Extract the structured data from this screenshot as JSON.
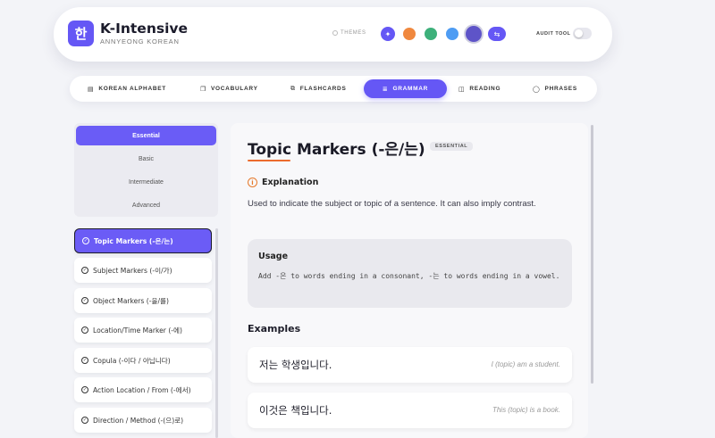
{
  "brand": {
    "logo_char": "한",
    "title": "K-Intensive",
    "subtitle": "ANNYEONG KOREAN"
  },
  "header": {
    "themes_label": "THEMES",
    "themes": [
      {
        "name": "indigo",
        "color": "#6557f5",
        "selected": true
      },
      {
        "name": "orange",
        "color": "#f0883e",
        "selected": false
      },
      {
        "name": "green",
        "color": "#3db07a",
        "selected": false
      },
      {
        "name": "blue",
        "color": "#4e9cf3",
        "selected": false
      },
      {
        "name": "dark",
        "color": "#5e54c8",
        "selected": false
      }
    ],
    "audit_label": "AUDIT TOOL",
    "audit_enabled": false
  },
  "nav": {
    "items": [
      {
        "label": "KOREAN ALPHABET",
        "icon": "book-icon",
        "active": false
      },
      {
        "label": "VOCABULARY",
        "icon": "copy-icon",
        "active": false
      },
      {
        "label": "FLASHCARDS",
        "icon": "cards-icon",
        "active": false
      },
      {
        "label": "GRAMMAR",
        "icon": "grammar-icon",
        "active": true
      },
      {
        "label": "READING",
        "icon": "open-book-icon",
        "active": false
      },
      {
        "label": "PHRASES",
        "icon": "chat-bubble-icon",
        "active": false
      }
    ]
  },
  "levels": {
    "items": [
      "Essential",
      "Basic",
      "Intermediate",
      "Advanced"
    ],
    "selected": "Essential"
  },
  "topics": {
    "items": [
      "Topic Markers (-은/는)",
      "Subject Markers (-이/가)",
      "Object Markers (-을/를)",
      "Location/Time Marker (-에)",
      "Copula (-이다 / 아닙니다)",
      "Action Location / From (-에서)",
      "Direction / Method (-(으)로)"
    ],
    "selected": "Topic Markers (-은/는)"
  },
  "lesson": {
    "title": "Topic Markers (-은/는)",
    "level_badge": "ESSENTIAL",
    "explanation_heading": "Explanation",
    "explanation": "Used to indicate the subject or topic of a sentence. It can also imply contrast.",
    "usage_heading": "Usage",
    "usage": "Add -은 to words ending in a consonant, -는 to words ending in a vowel.",
    "examples_heading": "Examples",
    "examples": [
      {
        "korean": "저는 학생입니다.",
        "english": "I (topic) am a student."
      },
      {
        "korean": "이것은 책입니다.",
        "english": "This (topic) is a book."
      }
    ]
  }
}
